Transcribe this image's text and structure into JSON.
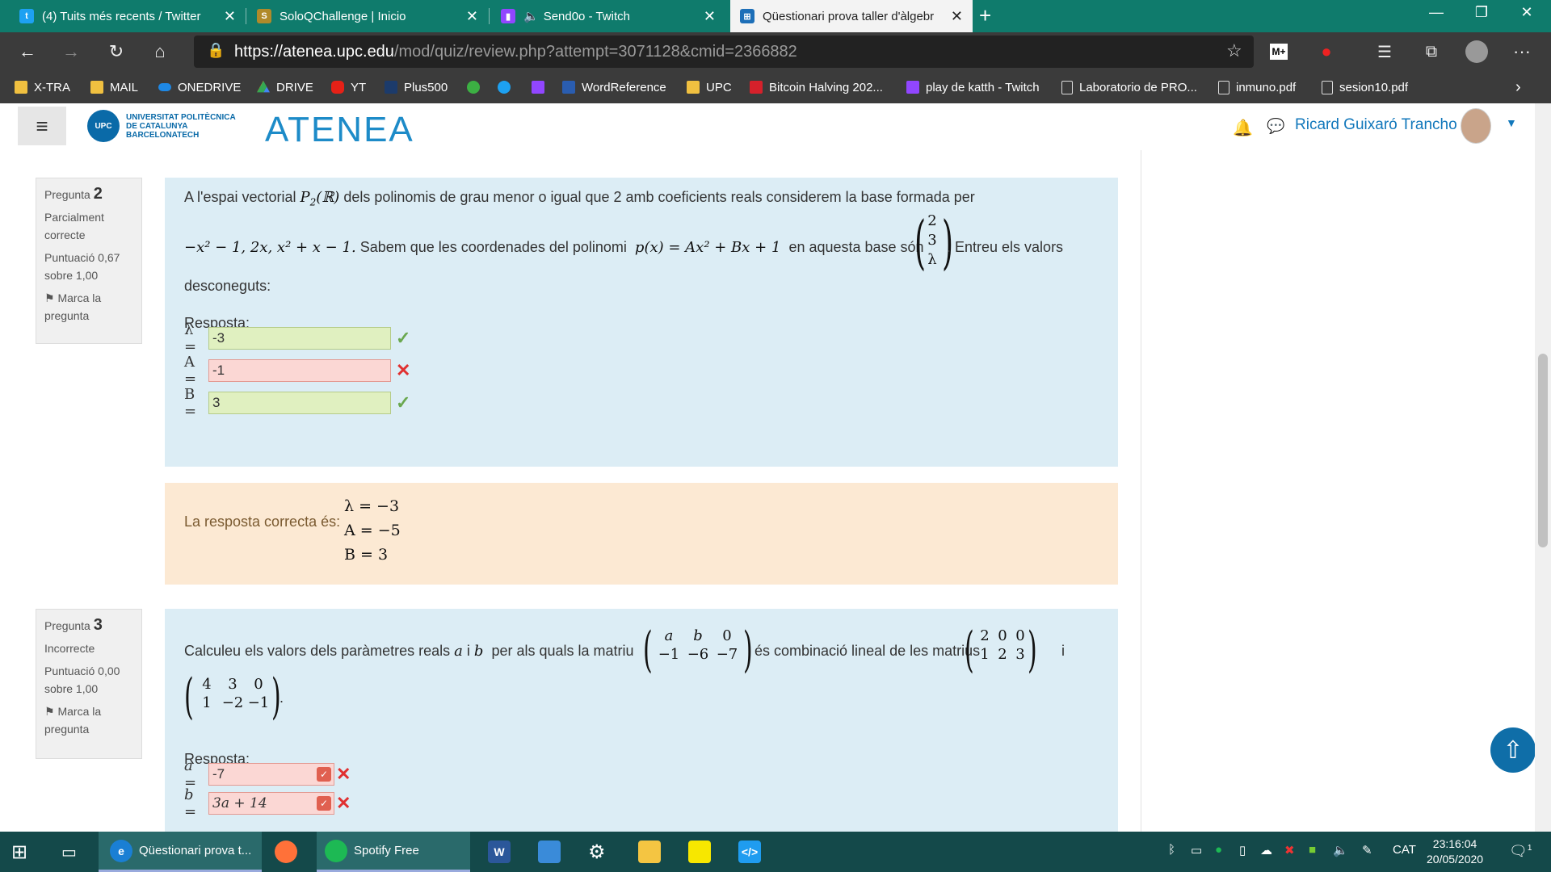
{
  "browser": {
    "tabs": [
      {
        "title": "(4) Tuits més recents / Twitter",
        "icon": "twitter-icon",
        "color": "#1da1f2"
      },
      {
        "title": "SoloQChallenge | Inicio",
        "icon": "soloq-icon",
        "color": "#b08a2a"
      },
      {
        "title": "Send0o - Twitch",
        "icon": "twitch-icon",
        "color": "#9146ff"
      },
      {
        "title": "Qüestionari prova taller d'àlgebr",
        "icon": "atenea-icon",
        "color": "#1d6fb8"
      }
    ],
    "url_prefix": "https://",
    "url_host": "atenea.upc.edu",
    "url_path": "/mod/quiz/review.php?attempt=3071128&cmid=2366882",
    "bookmarks": [
      {
        "label": "X-TRA",
        "icon": "folder-icon"
      },
      {
        "label": "MAIL",
        "icon": "folder-icon"
      },
      {
        "label": "ONEDRIVE",
        "icon": "onedrive-icon"
      },
      {
        "label": "DRIVE",
        "icon": "drive-icon"
      },
      {
        "label": "YT",
        "icon": "youtube-icon"
      },
      {
        "label": "Plus500",
        "icon": "plus500-icon"
      },
      {
        "label": "",
        "icon": "green-icon"
      },
      {
        "label": "",
        "icon": "twitter-icon"
      },
      {
        "label": "",
        "icon": "twitch-icon"
      },
      {
        "label": "WordReference",
        "icon": "wordreference-icon"
      },
      {
        "label": "UPC",
        "icon": "folder-icon"
      },
      {
        "label": "Bitcoin Halving 202...",
        "icon": "bitcoin-icon"
      },
      {
        "label": "play de katth - Twitch",
        "icon": "twitch-icon"
      },
      {
        "label": "Laboratorio de PRO...",
        "icon": "page-icon"
      },
      {
        "label": "inmuno.pdf",
        "icon": "page-icon"
      },
      {
        "label": "sesion10.pdf",
        "icon": "page-icon"
      }
    ]
  },
  "site": {
    "university": [
      "UNIVERSITAT POLITÈCNICA",
      "DE CATALUNYA",
      "BARCELONATECH"
    ],
    "logo_text": "ATENEA",
    "user_name": "Ricard Guixaró Trancho"
  },
  "q2": {
    "label": "Pregunta",
    "number": "2",
    "state": "Parcialment correcte",
    "score": "Puntuació 0,67 sobre 1,00",
    "flag": "Marca la pregunta",
    "text1a": "A l'espai vectorial",
    "text1b": "dels polinomis de grau menor o igual que 2 amb coeficients reals considerem la base formada per",
    "basis": "−x² − 1,  2x,  x² + x − 1.",
    "text2a": "Sabem que les coordenades del polinomi",
    "poly": "p(x) = Ax² + Bx + 1",
    "text2b": "en aquesta base  són",
    "vec": [
      "2",
      "3",
      "λ"
    ],
    "text2c": ". Entreu els valors",
    "text3": "desconeguts:",
    "answer_label": "Resposta:",
    "answers": [
      {
        "label": "λ =",
        "value": "-3",
        "status": "correct"
      },
      {
        "label": "A =",
        "value": "-1",
        "status": "incorrect"
      },
      {
        "label": "B =",
        "value": "3",
        "status": "correct"
      }
    ],
    "correct_label": "La resposta correcta és:",
    "correct": [
      "λ = −3",
      "A = −5",
      "B = 3"
    ]
  },
  "q3": {
    "label": "Pregunta",
    "number": "3",
    "state": "Incorrecte",
    "score": "Puntuació 0,00 sobre 1,00",
    "flag": "Marca la pregunta",
    "text1a": "Calculeu els valors dels paràmetres reals",
    "text1b": "per als quals la matriu",
    "text1c": "és combinació lineal de les matrius",
    "m1": [
      [
        "a",
        "b",
        "0"
      ],
      [
        "−1",
        "−6",
        "−7"
      ]
    ],
    "m2": [
      [
        "2",
        "0",
        "0"
      ],
      [
        "1",
        "2",
        "3"
      ]
    ],
    "m3": [
      [
        "4",
        "3",
        "0"
      ],
      [
        "1",
        "−2",
        "−1"
      ]
    ],
    "answer_label": "Resposta:",
    "answers": [
      {
        "label": "a =",
        "value": "-7",
        "status": "incorrect"
      },
      {
        "label": "b =",
        "value": "3a + 14",
        "status": "incorrect"
      }
    ]
  },
  "taskbar": {
    "items": [
      {
        "label": "Qüestionari prova t...",
        "icon": "edge-icon"
      },
      {
        "label": "",
        "icon": "firefox-icon"
      },
      {
        "label": "Spotify Free",
        "icon": "spotify-icon"
      },
      {
        "label": "",
        "icon": "word-icon"
      },
      {
        "label": "",
        "icon": "contacts-icon"
      },
      {
        "label": "",
        "icon": "settings-icon"
      },
      {
        "label": "",
        "icon": "explorer-icon"
      },
      {
        "label": "",
        "icon": "sticky-notes-icon"
      },
      {
        "label": "",
        "icon": "vscode-icon"
      }
    ],
    "lang": "CAT",
    "time": "23:16:04",
    "date": "20/05/2020",
    "notif_count": "1"
  }
}
